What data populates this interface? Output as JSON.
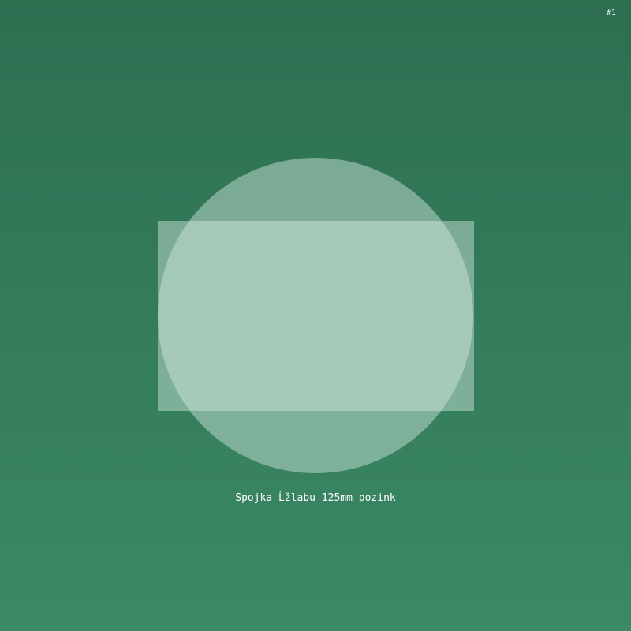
{
  "badge": {
    "text": "#1"
  },
  "product": {
    "name": "Spojka Ĺžlabu 125mm pozink"
  },
  "colors": {
    "background_top": "#2d6e51",
    "background_bottom": "#3b8966",
    "shape_fill": "#d6ece3"
  },
  "illustration": {
    "shapes": [
      "circle",
      "rectangle"
    ]
  }
}
